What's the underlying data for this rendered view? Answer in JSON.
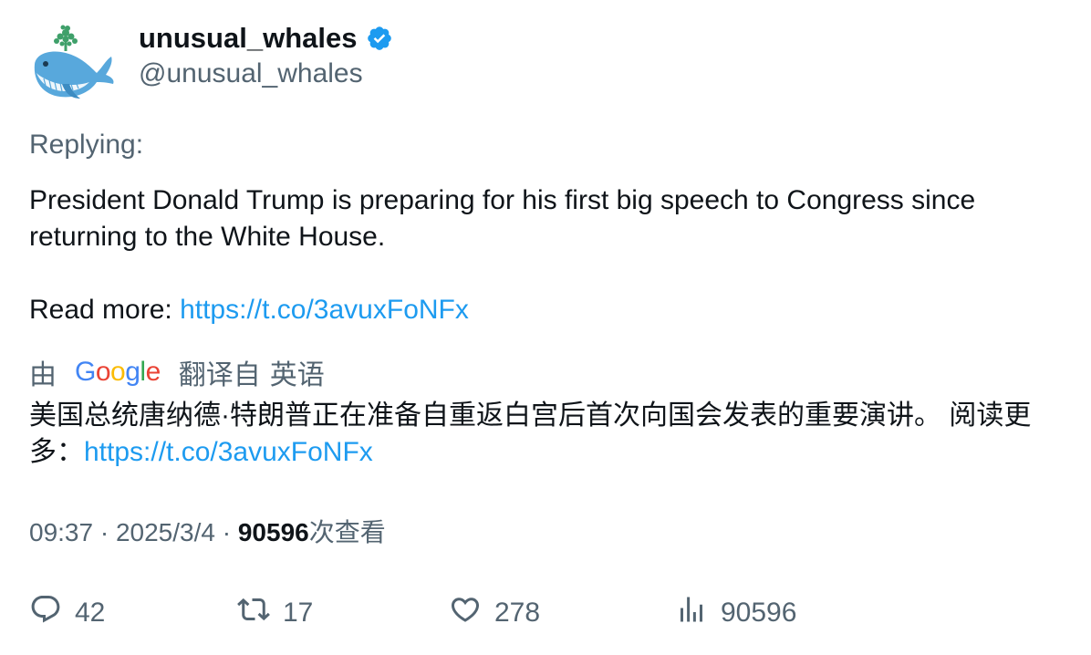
{
  "author": {
    "display_name": "unusual_whales",
    "handle": "@unusual_whales",
    "verified": true,
    "avatar_icon": "whale-avatar-icon"
  },
  "replying_label": "Replying:",
  "body": {
    "line1": "President Donald Trump is preparing for his first big speech to Congress since returning to the White House.",
    "read_more_label": "Read more: ",
    "link": "https://t.co/3avuxFoNFx"
  },
  "translation": {
    "by_label": "由",
    "google_letters": [
      "G",
      "o",
      "o",
      "g",
      "l",
      "e"
    ],
    "from_label": "翻译自",
    "language": "英语",
    "text": "美国总统唐纳德·特朗普正在准备自重返白宫后首次向国会发表的重要演讲。 阅读更多：",
    "link": "https://t.co/3avuxFoNFx"
  },
  "meta": {
    "time": "09:37",
    "separator": " · ",
    "date": "2025/3/4",
    "views_count": "90596",
    "views_label": "次查看"
  },
  "actions": {
    "replies": "42",
    "retweets": "17",
    "likes": "278",
    "views": "90596"
  },
  "colors": {
    "text": "#0f1419",
    "secondary": "#536471",
    "link": "#1d9bf0",
    "verified": "#1d9bf0"
  }
}
